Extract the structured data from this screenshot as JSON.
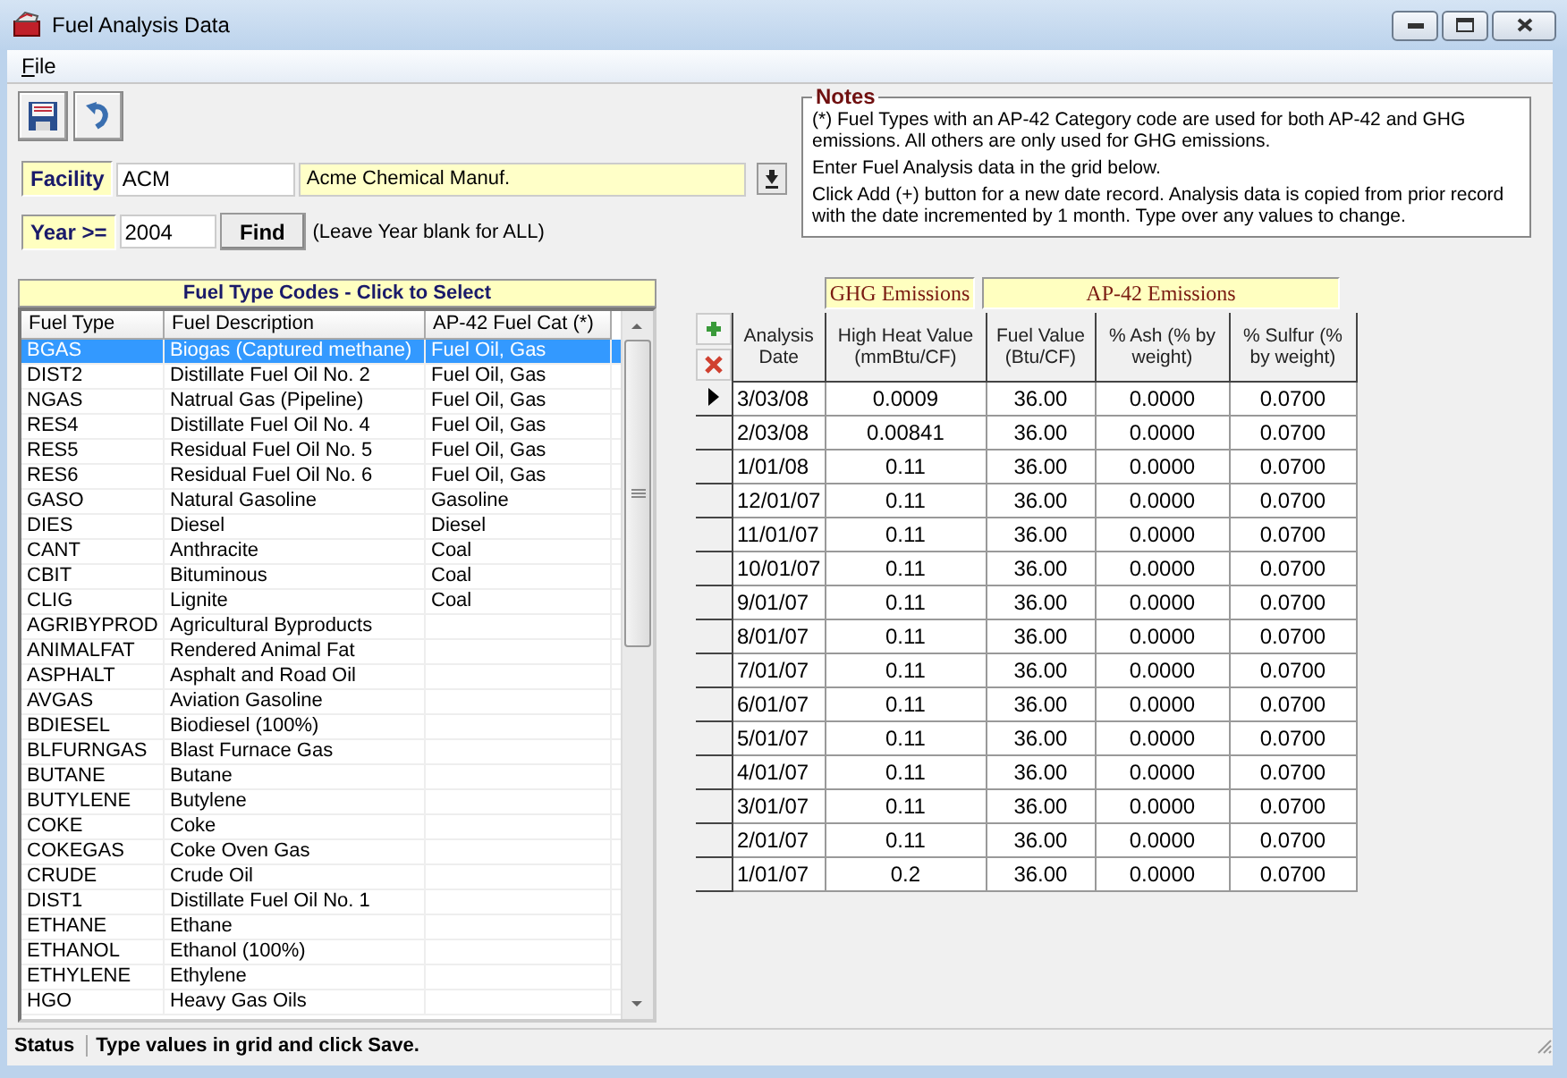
{
  "window": {
    "title": "Fuel Analysis Data"
  },
  "menu": [
    {
      "label": "File"
    }
  ],
  "facility": {
    "label": "Facility",
    "code": "ACM",
    "name": "Acme Chemical Manuf."
  },
  "year": {
    "label": "Year >=",
    "value": "2004",
    "button": "Find",
    "hint": "(Leave Year blank for ALL)"
  },
  "notes": {
    "title": "Notes",
    "paragraphs": [
      "(*)  Fuel Types with an AP-42 Category code are used for both AP-42 and GHG emissions.  All others are only used for GHG emissions.",
      "Enter Fuel Analysis data in the grid below.",
      "Click Add (+) button for a new date record.  Analysis data is copied from prior record with the date incremented by 1 month.  Type over any values to change."
    ]
  },
  "fuel_list": {
    "title": "Fuel Type Codes - Click to Select",
    "columns": [
      "Fuel Type",
      "Fuel Description",
      "AP-42 Fuel Cat (*)"
    ],
    "rows": [
      {
        "code": "BGAS",
        "description": "Biogas (Captured methane)",
        "category": "Fuel Oil, Gas",
        "selected": true
      },
      {
        "code": "DIST2",
        "description": "Distillate Fuel Oil No. 2",
        "category": "Fuel Oil, Gas",
        "selected": false
      },
      {
        "code": "NGAS",
        "description": "Natrual Gas (Pipeline)",
        "category": "Fuel Oil, Gas",
        "selected": false
      },
      {
        "code": "RES4",
        "description": "Distillate Fuel Oil No. 4",
        "category": "Fuel Oil, Gas",
        "selected": false
      },
      {
        "code": "RES5",
        "description": "Residual Fuel Oil No. 5",
        "category": "Fuel Oil, Gas",
        "selected": false
      },
      {
        "code": "RES6",
        "description": "Residual Fuel Oil No. 6",
        "category": "Fuel Oil, Gas",
        "selected": false
      },
      {
        "code": "GASO",
        "description": "Natural Gasoline",
        "category": "Gasoline",
        "selected": false
      },
      {
        "code": "DIES",
        "description": "Diesel",
        "category": "Diesel",
        "selected": false
      },
      {
        "code": "CANT",
        "description": "Anthracite",
        "category": "Coal",
        "selected": false
      },
      {
        "code": "CBIT",
        "description": "Bituminous",
        "category": "Coal",
        "selected": false
      },
      {
        "code": "CLIG",
        "description": "Lignite",
        "category": "Coal",
        "selected": false
      },
      {
        "code": "AGRIBYPROD",
        "description": "Agricultural Byproducts",
        "selected": false
      },
      {
        "code": "ANIMALFAT",
        "description": "Rendered Animal Fat",
        "selected": false
      },
      {
        "code": "ASPHALT",
        "description": "Asphalt and Road Oil",
        "selected": false
      },
      {
        "code": "AVGAS",
        "description": "Aviation Gasoline",
        "selected": false
      },
      {
        "code": "BDIESEL",
        "description": "Biodiesel (100%)",
        "selected": false
      },
      {
        "code": "BLFURNGAS",
        "description": "Blast Furnace Gas",
        "selected": false
      },
      {
        "code": "BUTANE",
        "description": "Butane",
        "selected": false
      },
      {
        "code": "BUTYLENE",
        "description": "Butylene",
        "selected": false
      },
      {
        "code": "COKE",
        "description": "Coke",
        "selected": false
      },
      {
        "code": "COKEGAS",
        "description": "Coke Oven Gas",
        "selected": false
      },
      {
        "code": "CRUDE",
        "description": "Crude Oil",
        "selected": false
      },
      {
        "code": "DIST1",
        "description": "Distillate Fuel Oil No. 1",
        "selected": false
      },
      {
        "code": "ETHANE",
        "description": "Ethane",
        "selected": false
      },
      {
        "code": "ETHANOL",
        "description": "Ethanol (100%)",
        "selected": false
      },
      {
        "code": "ETHYLENE",
        "description": "Ethylene",
        "selected": false
      },
      {
        "code": "HGO",
        "description": "Heavy Gas Oils",
        "selected": false
      }
    ]
  },
  "grid": {
    "bands": [
      "GHG Emissions",
      "AP-42 Emissions"
    ],
    "columns": [
      "Analysis Date",
      "High Heat Value (mmBtu/CF)",
      "Fuel Value (Btu/CF)",
      "% Ash (% by weight)",
      "% Sulfur (% by weight)"
    ],
    "rows": [
      {
        "current": true,
        "cells": [
          "3/03/08",
          "0.0009",
          "36.00",
          "0.0000",
          "0.0700"
        ]
      },
      {
        "current": false,
        "cells": [
          "2/03/08",
          "0.00841",
          "36.00",
          "0.0000",
          "0.0700"
        ]
      },
      {
        "current": false,
        "cells": [
          "1/01/08",
          "0.11",
          "36.00",
          "0.0000",
          "0.0700"
        ]
      },
      {
        "current": false,
        "cells": [
          "12/01/07",
          "0.11",
          "36.00",
          "0.0000",
          "0.0700"
        ]
      },
      {
        "current": false,
        "cells": [
          "11/01/07",
          "0.11",
          "36.00",
          "0.0000",
          "0.0700"
        ]
      },
      {
        "current": false,
        "cells": [
          "10/01/07",
          "0.11",
          "36.00",
          "0.0000",
          "0.0700"
        ]
      },
      {
        "current": false,
        "cells": [
          "9/01/07",
          "0.11",
          "36.00",
          "0.0000",
          "0.0700"
        ]
      },
      {
        "current": false,
        "cells": [
          "8/01/07",
          "0.11",
          "36.00",
          "0.0000",
          "0.0700"
        ]
      },
      {
        "current": false,
        "cells": [
          "7/01/07",
          "0.11",
          "36.00",
          "0.0000",
          "0.0700"
        ]
      },
      {
        "current": false,
        "cells": [
          "6/01/07",
          "0.11",
          "36.00",
          "0.0000",
          "0.0700"
        ]
      },
      {
        "current": false,
        "cells": [
          "5/01/07",
          "0.11",
          "36.00",
          "0.0000",
          "0.0700"
        ]
      },
      {
        "current": false,
        "cells": [
          "4/01/07",
          "0.11",
          "36.00",
          "0.0000",
          "0.0700"
        ]
      },
      {
        "current": false,
        "cells": [
          "3/01/07",
          "0.11",
          "36.00",
          "0.0000",
          "0.0700"
        ]
      },
      {
        "current": false,
        "cells": [
          "2/01/07",
          "0.11",
          "36.00",
          "0.0000",
          "0.0700"
        ]
      },
      {
        "current": false,
        "cells": [
          "1/01/07",
          "0.2",
          "36.00",
          "0.0000",
          "0.0700"
        ]
      }
    ]
  },
  "status_bar": {
    "label": "Status",
    "text": "Type values in grid and click Save."
  }
}
